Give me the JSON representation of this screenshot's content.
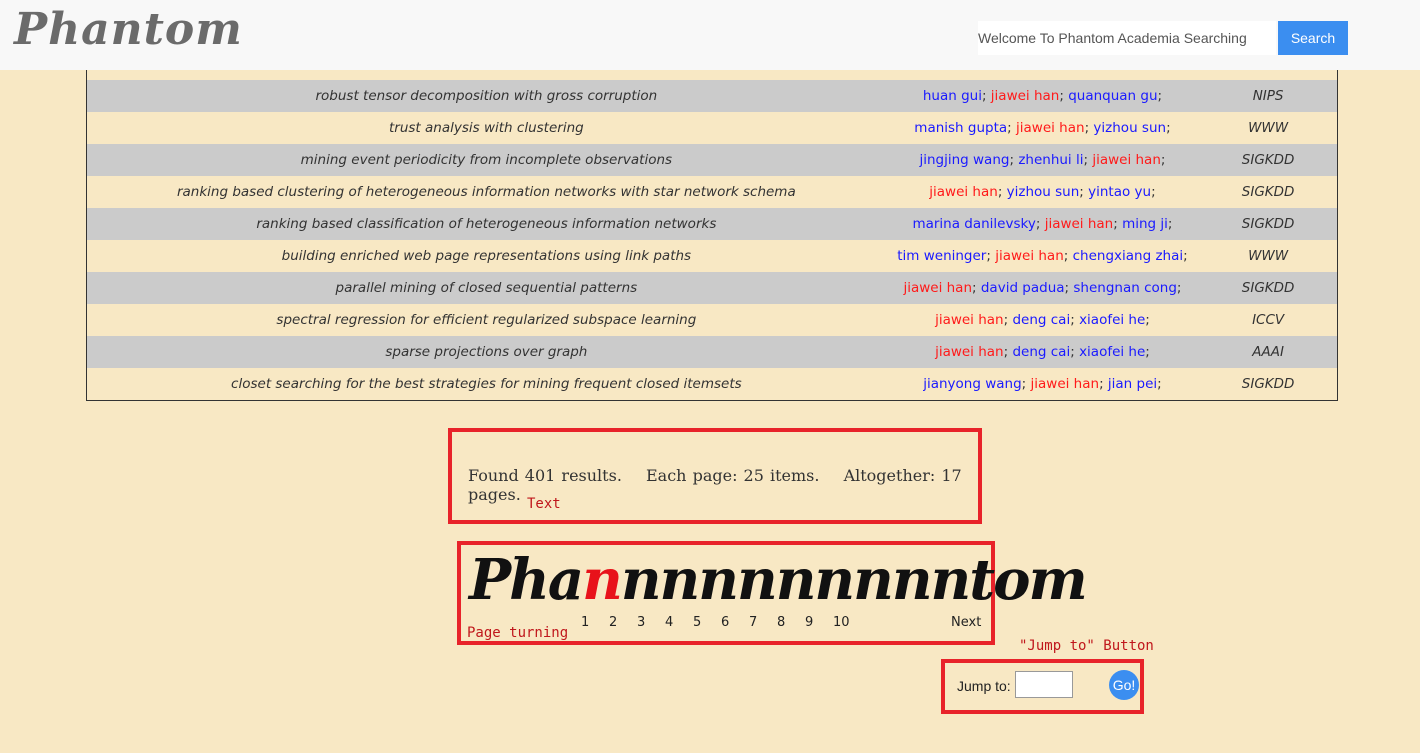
{
  "header": {
    "logo": "Phantom",
    "search_placeholder": "Welcome To Phantom Academia Searching",
    "search_button": "Search"
  },
  "results": [
    {
      "title": "robust tensor decomposition with gross corruption",
      "authors": [
        "huan gui",
        "jiawei han",
        "quanquan gu"
      ],
      "venue": "NIPS"
    },
    {
      "title": "trust analysis with clustering",
      "authors": [
        "manish gupta",
        "jiawei han",
        "yizhou sun"
      ],
      "venue": "WWW"
    },
    {
      "title": "mining event periodicity from incomplete observations",
      "authors": [
        "jingjing wang",
        "zhenhui li",
        "jiawei han"
      ],
      "venue": "SIGKDD"
    },
    {
      "title": "ranking based clustering of heterogeneous information networks with star network schema",
      "authors": [
        "jiawei han",
        "yizhou sun",
        "yintao yu"
      ],
      "venue": "SIGKDD"
    },
    {
      "title": "ranking based classification of heterogeneous information networks",
      "authors": [
        "marina danilevsky",
        "jiawei han",
        "ming ji"
      ],
      "venue": "SIGKDD"
    },
    {
      "title": "building enriched web page representations using link paths",
      "authors": [
        "tim weninger",
        "jiawei han",
        "chengxiang zhai"
      ],
      "venue": "WWW"
    },
    {
      "title": "parallel mining of closed sequential patterns",
      "authors": [
        "jiawei han",
        "david padua",
        "shengnan cong"
      ],
      "venue": "SIGKDD"
    },
    {
      "title": "spectral regression for efficient regularized subspace learning",
      "authors": [
        "jiawei han",
        "deng cai",
        "xiaofei he"
      ],
      "venue": "ICCV"
    },
    {
      "title": "sparse projections over graph",
      "authors": [
        "jiawei han",
        "deng cai",
        "xiaofei he"
      ],
      "venue": "AAAI"
    },
    {
      "title": "closet searching for the best strategies for mining frequent closed itemsets",
      "authors": [
        "jianyong wang",
        "jiawei han",
        "jian pei"
      ],
      "venue": "SIGKDD"
    }
  ],
  "highlight_author": "jiawei han",
  "stats": {
    "found": "Found 401 results.",
    "per_page": "Each page: 25 items.",
    "total": "Altogether: 17 pages."
  },
  "annotations": {
    "text": "Text",
    "page_turning": "Page  turning",
    "jump_button": "\"Jump to\" Button"
  },
  "pager": {
    "logo_prefix": "Pha",
    "logo_current": "n",
    "logo_rest": "nnnnnnnnntom",
    "pages": [
      "1",
      "2",
      "3",
      "4",
      "5",
      "6",
      "7",
      "8",
      "9",
      "10"
    ],
    "next": "Next"
  },
  "jump": {
    "label": "Jump to:",
    "button": "Go!"
  },
  "colors": {
    "background": "#f8e8c4",
    "row_alt": "#cbcbcb",
    "author": "#1a1aff",
    "author_highlight": "#ff1a1a",
    "annotation_box": "#e8232a",
    "button": "#3b8ef0"
  }
}
